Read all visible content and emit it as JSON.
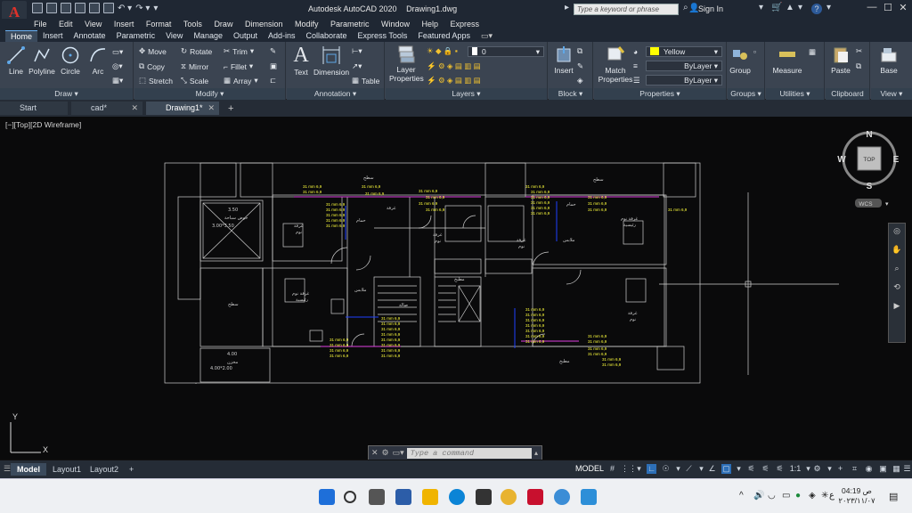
{
  "window": {
    "app_name": "Autodesk AutoCAD 2020",
    "file_name": "Drawing1.dwg",
    "search_placeholder": "Type a keyword or phrase",
    "sign_in": "Sign In"
  },
  "menu": [
    "File",
    "Edit",
    "View",
    "Insert",
    "Format",
    "Tools",
    "Draw",
    "Dimension",
    "Modify",
    "Parametric",
    "Window",
    "Help",
    "Express"
  ],
  "ribbon_tabs": [
    "Home",
    "Insert",
    "Annotate",
    "Parametric",
    "View",
    "Manage",
    "Output",
    "Add-ins",
    "Collaborate",
    "Express Tools",
    "Featured Apps"
  ],
  "ribbon": {
    "draw": {
      "title": "Draw",
      "line": "Line",
      "polyline": "Polyline",
      "circle": "Circle",
      "arc": "Arc"
    },
    "modify": {
      "title": "Modify",
      "move": "Move",
      "rotate": "Rotate",
      "trim": "Trim",
      "copy": "Copy",
      "mirror": "Mirror",
      "fillet": "Fillet",
      "stretch": "Stretch",
      "scale": "Scale",
      "array": "Array"
    },
    "annotation": {
      "title": "Annotation",
      "text": "Text",
      "dimension": "Dimension",
      "table": "Table"
    },
    "layers": {
      "title": "Layers",
      "layer_properties_1": "Layer",
      "layer_properties_2": "Properties",
      "current_layer": "0"
    },
    "block": {
      "title": "Block",
      "insert": "Insert"
    },
    "properties": {
      "title": "Properties",
      "match_1": "Match",
      "match_2": "Properties",
      "color": "Yellow",
      "linetype": "ByLayer",
      "lineweight": "ByLayer"
    },
    "groups": {
      "title": "Groups",
      "group": "Group"
    },
    "utilities": {
      "title": "Utilities",
      "measure": "Measure"
    },
    "clipboard": {
      "title": "Clipboard",
      "paste": "Paste"
    },
    "view": {
      "title": "View",
      "base": "Base"
    }
  },
  "file_tabs": [
    {
      "label": "Start"
    },
    {
      "label": "cad*"
    },
    {
      "label": "Drawing1*"
    }
  ],
  "canvas": {
    "viewport_label": "[−][Top][2D Wireframe]",
    "viewcube": {
      "north": "N",
      "south": "S",
      "east": "E",
      "west": "W",
      "face": "TOP",
      "wcs": "WCS"
    },
    "ucs": {
      "x": "X",
      "y": "Y"
    },
    "drawing_text": {
      "room_top_left_1": "حوض سباحة",
      "room_top_left_2": "3.50",
      "room_top_left_dim": "3.00*3.50",
      "room_bottom_left_1": "غرفة نوم",
      "room_bottom_left_2": "رئيسية",
      "room_mid_left": "حمام",
      "room_center": "غرفة نوم",
      "room_right_1": "غرفة نوم",
      "room_right_2": "رئيسية",
      "room_right_mid": "مطبخ",
      "dim_bottom": "4.00",
      "dim_bottom2": "4.00*2.00",
      "label_kitchen": "مطبخ",
      "label_living": "صالة",
      "label_sat": "سطح",
      "pipe_label": "31 mm 6,9"
    }
  },
  "command": {
    "placeholder": "Type a command"
  },
  "status": {
    "layouts": [
      "Model",
      "Layout1",
      "Layout2"
    ],
    "model": "MODEL",
    "scale": "1:1"
  },
  "taskbar": {
    "time": "04:19 ص",
    "date": "٢٠٢٣/١١/٠٧",
    "lang": "ع"
  }
}
